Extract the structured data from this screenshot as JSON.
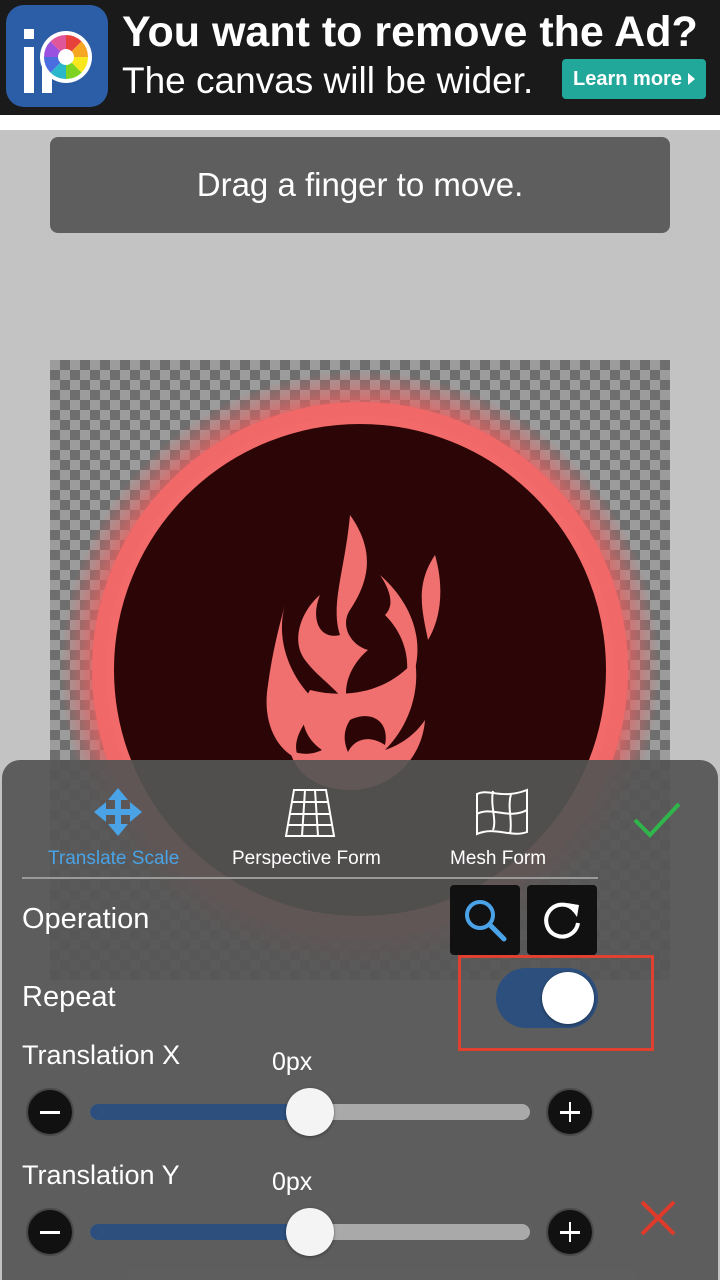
{
  "ad": {
    "title": "You want to remove the Ad?",
    "subtitle": "The canvas will be wider.",
    "button_label": "Learn more"
  },
  "toast": {
    "message": "Drag a finger to move."
  },
  "panel": {
    "tabs": [
      {
        "label": "Translate Scale",
        "icon": "move-arrows-icon",
        "active": true,
        "color": "#4aa3e6"
      },
      {
        "label": "Perspective Form",
        "icon": "perspective-grid-icon",
        "active": false,
        "color": "#ffffff"
      },
      {
        "label": "Mesh Form",
        "icon": "mesh-grid-icon",
        "active": false,
        "color": "#ffffff"
      }
    ],
    "confirm_icon": "checkmark-icon",
    "cancel_icon": "x-icon",
    "operation_label": "Operation",
    "operation_buttons": [
      "zoom-icon",
      "rotate-reset-icon"
    ],
    "repeat_label": "Repeat",
    "repeat_on": true,
    "translation_x": {
      "label": "Translation X",
      "value": "0px",
      "slider_fraction": 0.5
    },
    "translation_y": {
      "label": "Translation Y",
      "value": "0px",
      "slider_fraction": 0.5
    }
  },
  "colors": {
    "accent_blue": "#4aa3e6",
    "toggle_on": "#2c4f7d",
    "confirm_green": "#2fb54a",
    "cancel_red": "#e03a2a",
    "highlight_red": "#e0412f"
  }
}
